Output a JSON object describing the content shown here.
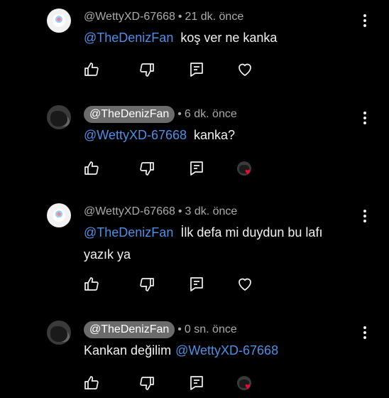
{
  "comments": [
    {
      "author": "@WettyXD-67668",
      "author_chip": false,
      "avatar": "light",
      "time": "21 dk. önce",
      "mention": "@TheDenizFan",
      "text": "koş ver ne kanka",
      "creator_heart": false
    },
    {
      "author": "@TheDenizFan",
      "author_chip": true,
      "avatar": "dark",
      "time": "6 dk. önce",
      "mention": "@WettyXD-67668",
      "text": "kanka?",
      "creator_heart": true
    },
    {
      "author": "@WettyXD-67668",
      "author_chip": false,
      "avatar": "light",
      "time": "3 dk. önce",
      "mention": "@TheDenizFan",
      "text": "İlk defa mi duydun bu lafı",
      "text2": "yazık ya",
      "creator_heart": false
    },
    {
      "author": "@TheDenizFan",
      "author_chip": true,
      "avatar": "dark",
      "time": "0 sn. önce",
      "text_before": "Kankan değilim",
      "mention": "@WettyXD-67668",
      "creator_heart": true
    }
  ],
  "icons": {
    "like": "thumbs-up-icon",
    "dislike": "thumbs-down-icon",
    "reply": "reply-icon",
    "heart": "heart-icon",
    "menu": "more-vertical-icon"
  },
  "colors": {
    "background": "#000000",
    "mention": "#4e8fe6",
    "chip": "#6b6b6b",
    "heart": "#ff0033"
  },
  "separator": "•"
}
